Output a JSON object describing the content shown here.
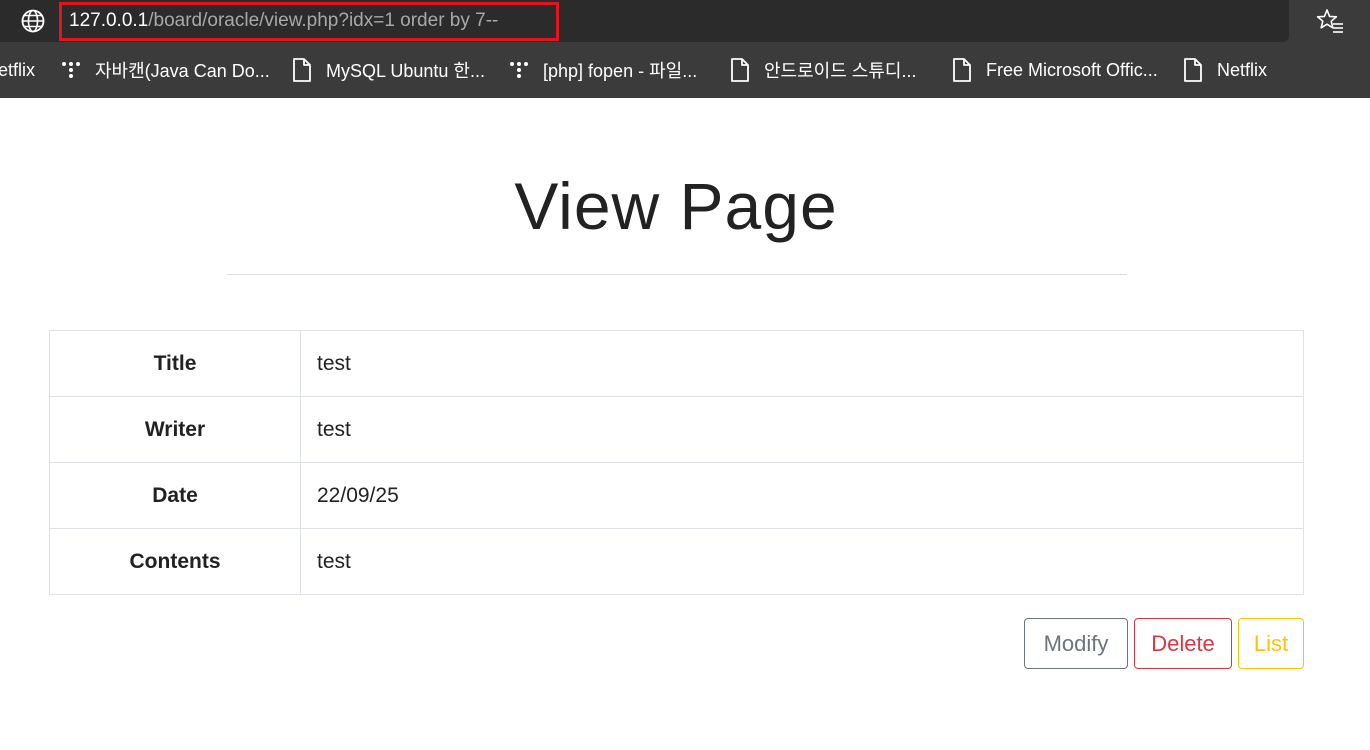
{
  "browser": {
    "url_host": "127.0.0.1",
    "url_path": "/board/oracle/view.php?idx=1 order by 7--",
    "bookmarks": [
      {
        "label": "etflix",
        "icon": "none"
      },
      {
        "label": "자바캔(Java Can Do...",
        "icon": "dots-icon"
      },
      {
        "label": "MySQL Ubuntu 한...",
        "icon": "page-icon"
      },
      {
        "label": "[php] fopen - 파일...",
        "icon": "dots-icon"
      },
      {
        "label": "안드로이드 스튜디...",
        "icon": "page-icon"
      },
      {
        "label": "Free Microsoft Offic...",
        "icon": "page-icon"
      },
      {
        "label": "Netflix",
        "icon": "page-icon"
      }
    ]
  },
  "page": {
    "title": "View Page",
    "rows": [
      {
        "label": "Title",
        "value": "test"
      },
      {
        "label": "Writer",
        "value": "test"
      },
      {
        "label": "Date",
        "value": "22/09/25"
      },
      {
        "label": "Contents",
        "value": "test"
      }
    ],
    "buttons": {
      "modify": "Modify",
      "delete": "Delete",
      "list": "List"
    }
  },
  "colors": {
    "url_highlight": "#e3141b",
    "modify": "#6c757d",
    "delete": "#dc3545",
    "list": "#ffc107"
  }
}
